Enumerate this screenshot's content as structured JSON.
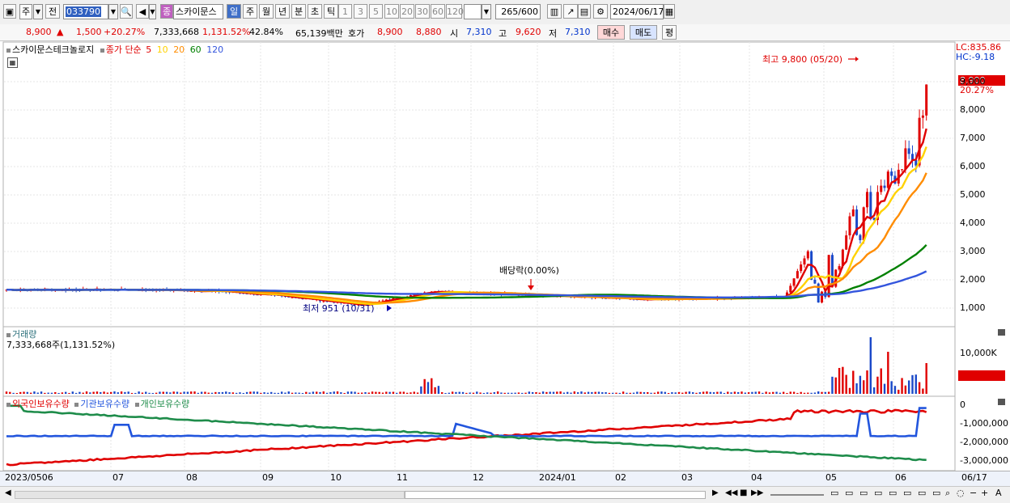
{
  "toolbar": {
    "period_label": "주",
    "prev_label": "전",
    "code": "033790",
    "name_prefix": "종",
    "name": "스카이문스",
    "periods": [
      "일",
      "주",
      "월",
      "년",
      "분",
      "초",
      "틱"
    ],
    "minute_options": [
      "1",
      "3",
      "5",
      "10",
      "20",
      "30",
      "60",
      "120"
    ],
    "count": "265",
    "count_total": "/600",
    "date": "2024/06/17"
  },
  "quote": {
    "price": "8,900",
    "arrow": "▲",
    "change": "1,500",
    "change_pct": "+20.27%",
    "volume": "7,333,668",
    "volume_pct": "1,131.52%",
    "turnover": "42.84%",
    "amount": "65,139백만",
    "ask_label": "호가",
    "ask": "8,900",
    "bid": "8,880",
    "open_label": "시",
    "open": "7,310",
    "high_label": "고",
    "high": "9,620",
    "low_label": "저",
    "low": "7,310",
    "buy": "매수",
    "sell": "매도",
    "eval": "평"
  },
  "price_panel": {
    "title": "스카이문스테크놀로지",
    "ma_label": "종가 단순",
    "ma_periods": [
      "5",
      "10",
      "20",
      "60",
      "120"
    ],
    "ma_colors": [
      "#e00000",
      "#ffd200",
      "#ff8c00",
      "#008000",
      "#3355dd"
    ],
    "lc": "LC:835.86",
    "hc": "HC:-9.18",
    "current_price": "8,900",
    "current_pct": "20.27%",
    "yticks": [
      "9,000",
      "8,000",
      "7,000",
      "6,000",
      "5,000",
      "4,000",
      "3,000",
      "2,000",
      "1,000"
    ],
    "high_note": "최고 9,800 (05/20)",
    "low_note": "최저 951 (10/31)",
    "dividend_note": "배당락(0.00%)"
  },
  "volume_panel": {
    "title": "거래량",
    "info": "7,333,668주(1,131.52%)",
    "ytick": "10,000K",
    "current": "7,334K",
    "current_pct": "1131.52%"
  },
  "holding_panel": {
    "series": [
      "외국인보유수량",
      "기관보유수량",
      "개인보유수량"
    ],
    "series_colors": [
      "#e00000",
      "#2255dd",
      "#1e8c4a"
    ],
    "yticks": [
      "0",
      "-1,000,000",
      "-2,000,000",
      "-3,000,000"
    ]
  },
  "xaxis": [
    "2023/0506",
    "07",
    "08",
    "09",
    "10",
    "11",
    "12",
    "2024/01",
    "02",
    "03",
    "04",
    "05",
    "06"
  ],
  "xaxis_right": "06/17",
  "chart_data": {
    "type": "candlestick",
    "title": "스카이문스테크놀로지",
    "y_range": [
      700,
      10000
    ],
    "approx_close_by_month": {
      "2023-05": 1650,
      "2023-06": 1650,
      "2023-07": 1650,
      "2023-08": 1600,
      "2023-09": 1400,
      "2023-10": 1100,
      "2023-11": 1600,
      "2023-12": 1500,
      "2024-01": 1400,
      "2024-02": 1300,
      "2024-03": 1350,
      "2024-04": 1400,
      "2024-05": 6500,
      "2024-06": 8900
    },
    "high": 9800,
    "low": 951
  }
}
